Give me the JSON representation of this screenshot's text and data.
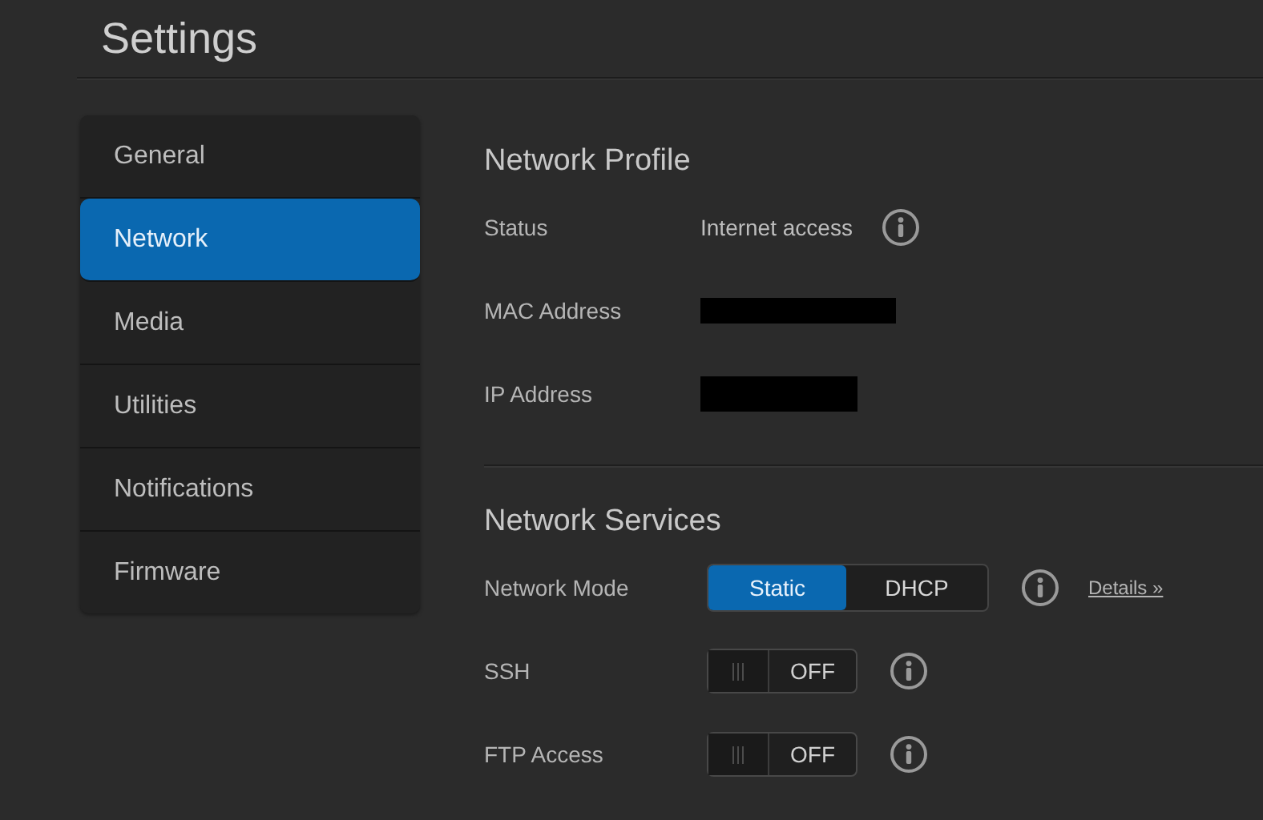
{
  "title": "Settings",
  "sidebar": {
    "items": [
      {
        "label": "General",
        "selected": false
      },
      {
        "label": "Network",
        "selected": true
      },
      {
        "label": "Media",
        "selected": false
      },
      {
        "label": "Utilities",
        "selected": false
      },
      {
        "label": "Notifications",
        "selected": false
      },
      {
        "label": "Firmware",
        "selected": false
      }
    ]
  },
  "sections": [
    {
      "title": "Network Profile",
      "rows": [
        {
          "label": "Status",
          "kind": "text",
          "value": "Internet access",
          "info": true
        },
        {
          "label": "MAC Address",
          "kind": "redacted",
          "info": false
        },
        {
          "label": "IP Address",
          "kind": "redacted",
          "info": false
        }
      ]
    },
    {
      "title": "Network Services",
      "rows": [
        {
          "label": "Network Mode",
          "kind": "segmented",
          "options": [
            {
              "label": "Static",
              "selected": true
            },
            {
              "label": "DHCP",
              "selected": false
            }
          ],
          "info": true,
          "link": "Details »"
        },
        {
          "label": "SSH",
          "kind": "toggle",
          "on": false,
          "state_text": "OFF",
          "info": true
        },
        {
          "label": "FTP Access",
          "kind": "toggle",
          "on": false,
          "state_text": "OFF",
          "info": true
        }
      ]
    }
  ]
}
